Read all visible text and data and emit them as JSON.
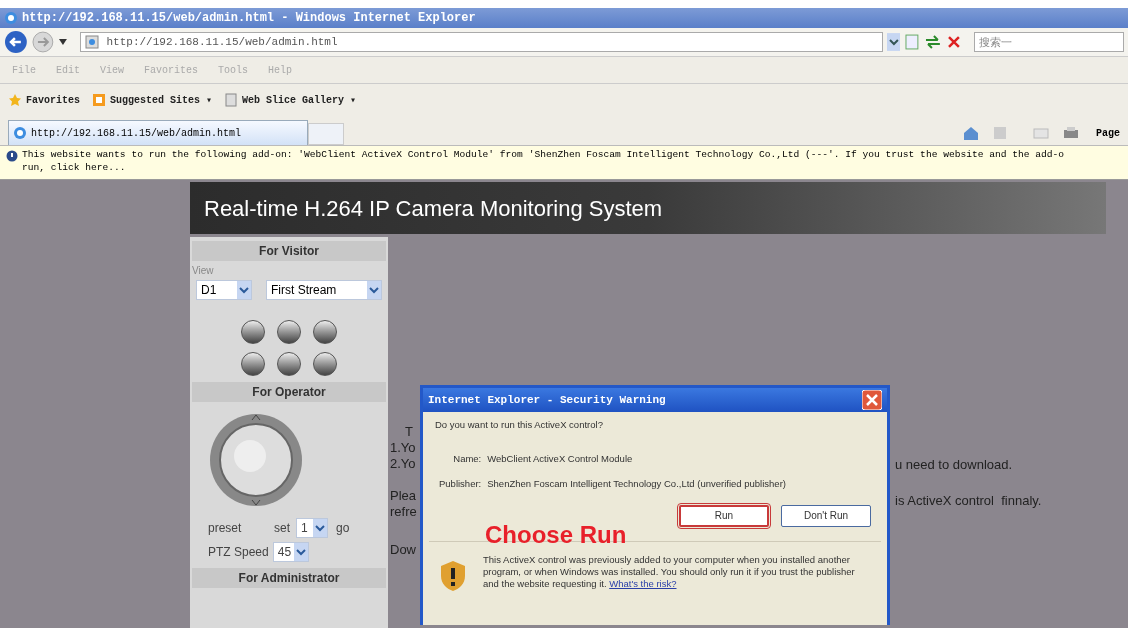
{
  "window": {
    "title": "http://192.168.11.15/web/admin.html - Windows Internet Explorer"
  },
  "address_bar": {
    "url": "http://192.168.11.15/web/admin.html",
    "search_placeholder": "搜索一"
  },
  "menu": [
    "File",
    "Edit",
    "View",
    "Favorites",
    "Tools",
    "Help"
  ],
  "favorites_bar": [
    {
      "label": "Favorites",
      "kind": "star"
    },
    {
      "label": "Suggested Sites ▾",
      "kind": "sites"
    },
    {
      "label": "Web Slice Gallery ▾",
      "kind": "slice"
    }
  ],
  "tabs": [
    {
      "label": "http://192.168.11.15/web/admin.html",
      "selected": true
    }
  ],
  "command_bar": {
    "page": "Page"
  },
  "info_bar": {
    "text": "This website wants to run the following add-on: 'WebClient ActiveX Control Module' from 'ShenZhen Foscam Intelligent Technology Co.,Ltd (---'. If you trust the website and the add-o",
    "link": "run, click here..."
  },
  "page": {
    "title": "Real-time H.264 IP Camera Monitoring System",
    "visitor": {
      "heading": "For Visitor",
      "view_label": "View",
      "resolution": "D1",
      "stream": "First Stream"
    },
    "operator": {
      "heading": "For Operator",
      "preset_label": "preset",
      "set_label": "set",
      "preset_value": "1",
      "go_label": "go",
      "speed_label": "PTZ Speed",
      "speed_value": "45"
    },
    "administrator": {
      "heading": "For Administrator"
    },
    "hidden_text_left": [
      "T",
      "1.Yo",
      "2.Yo",
      "Plea",
      "refre",
      "Dow"
    ],
    "hidden_text_right": [
      "u need to download.",
      "is ActiveX control  finnaly."
    ]
  },
  "dialog": {
    "title": "Internet Explorer - Security Warning",
    "question": "Do you want to run this ActiveX control?",
    "fields": [
      {
        "label": "Name:",
        "value": "WebClient ActiveX Control Module"
      },
      {
        "label": "Publisher:",
        "value": "ShenZhen Foscam Intelligent Technology Co.,Ltd (unverified publisher)"
      }
    ],
    "buttons": [
      {
        "label": "Run",
        "highlighted": true
      },
      {
        "label": "Don't Run",
        "highlighted": false
      }
    ],
    "warning": "This ActiveX control was previously added to your computer when you installed another program, or when Windows was installed. You should only run it if you trust the publisher and the website requesting it.",
    "risk_link": "What's the risk?"
  },
  "annotation": "Choose Run"
}
